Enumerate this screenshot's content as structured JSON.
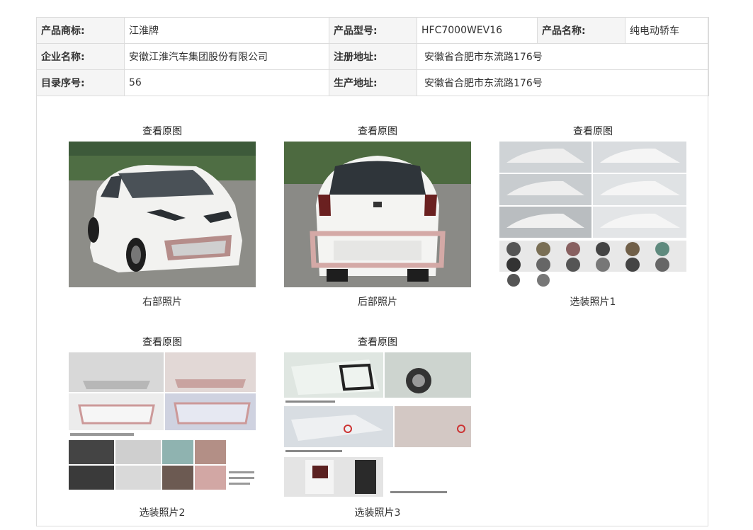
{
  "info": {
    "trademark_label": "产品商标:",
    "trademark_value": "江淮牌",
    "model_label": "产品型号:",
    "model_value": "HFC7000WEV16",
    "name_label": "产品名称:",
    "name_value": "纯电动轿车",
    "company_label": "企业名称:",
    "company_value": "安徽江淮汽车集团股份有限公司",
    "reg_addr_label": "注册地址:",
    "reg_addr_value": "安徽省合肥市东流路176号",
    "catalog_label": "目录序号:",
    "catalog_value": "56",
    "prod_addr_label": "生产地址:",
    "prod_addr_value": "安徽省合肥市东流路176号"
  },
  "gallery": [
    {
      "link": "查看原图",
      "caption": "右部照片"
    },
    {
      "link": "查看原图",
      "caption": "后部照片"
    },
    {
      "link": "查看原图",
      "caption": "选装照片1"
    },
    {
      "link": "查看原图",
      "caption": "选装照片2"
    },
    {
      "link": "查看原图",
      "caption": "选装照片3"
    }
  ]
}
